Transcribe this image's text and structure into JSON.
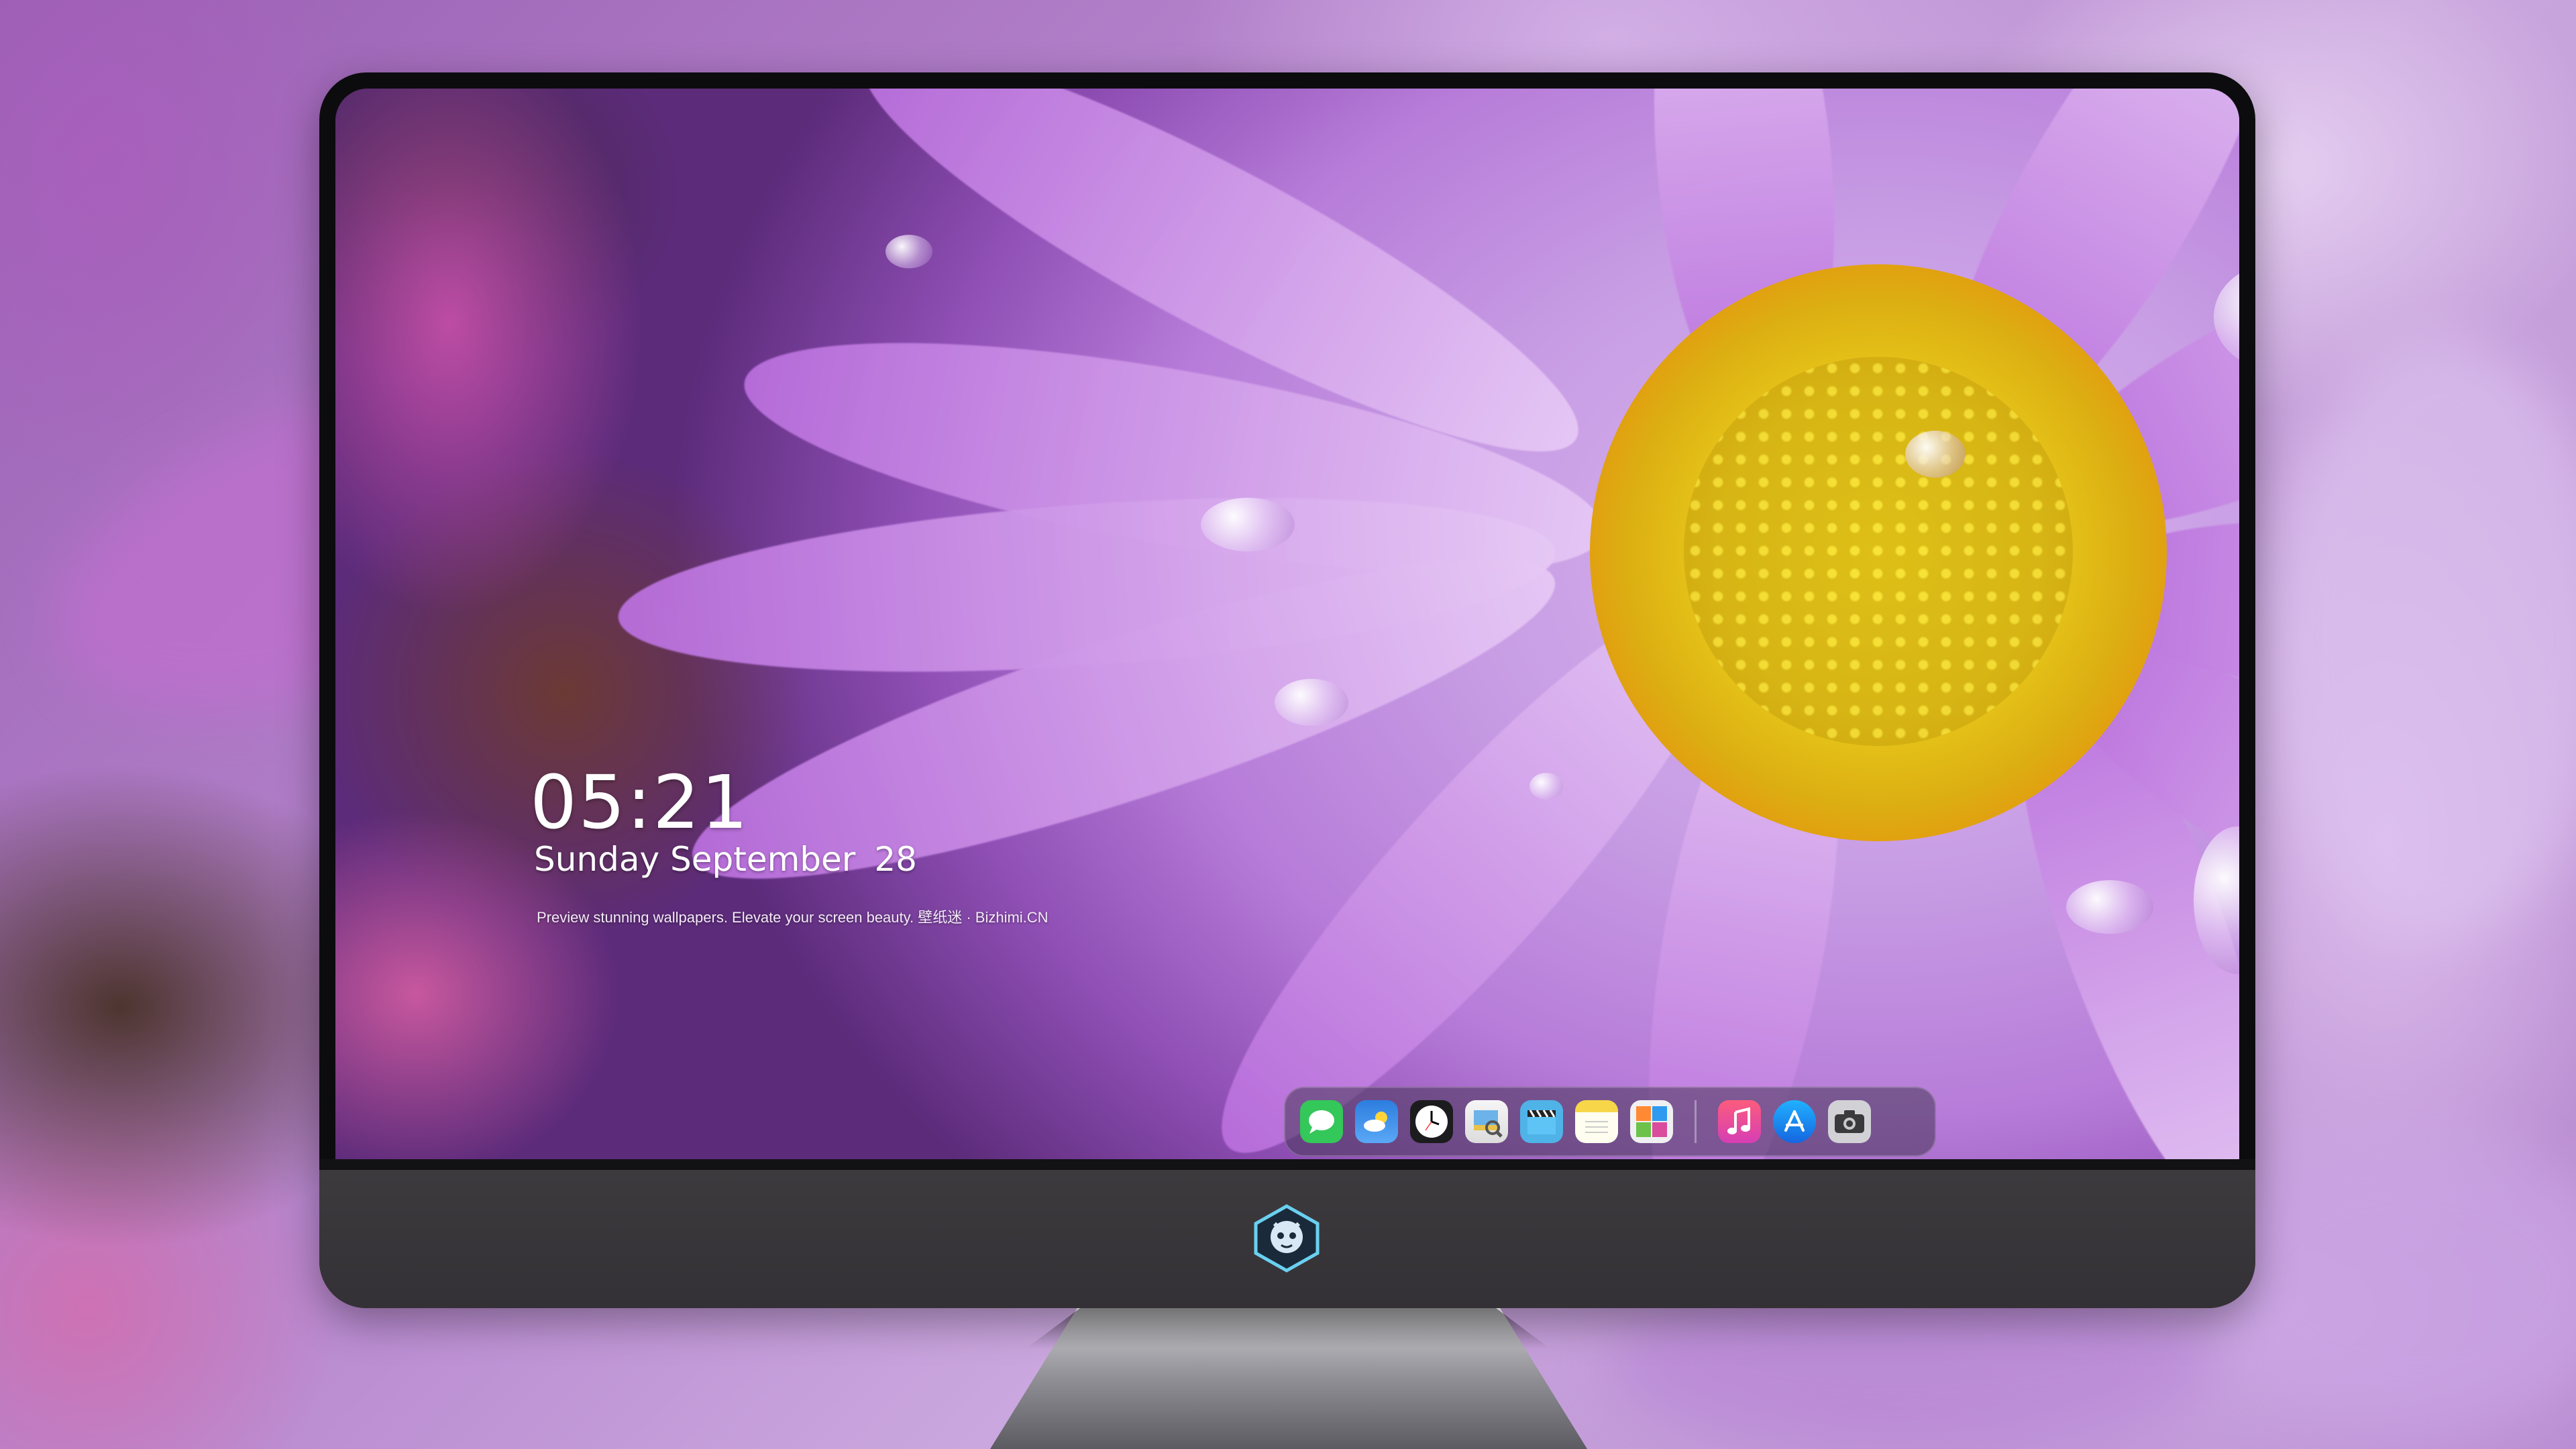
{
  "lock_screen": {
    "time": "05:21",
    "weekday_month": "Sunday September",
    "day": "28",
    "caption": "Preview stunning wallpapers. Elevate your screen beauty. 壁纸迷 · Bizhimi.CN"
  },
  "dock": {
    "apps": [
      {
        "name": "messages-icon",
        "color": "#34c759",
        "glyph": "💬"
      },
      {
        "name": "weather-icon",
        "color": "#3a8ef5",
        "glyph": "☁"
      },
      {
        "name": "clock-icon",
        "color": "#1c1c1e",
        "glyph": "🕓"
      },
      {
        "name": "preview-icon",
        "color": "#f2c94c",
        "glyph": "🔍"
      },
      {
        "name": "clips-icon",
        "color": "#4fb3e8",
        "glyph": "🎬"
      },
      {
        "name": "notes-icon",
        "color": "#f7d64a",
        "glyph": "≡"
      },
      {
        "name": "photo-booth-icon",
        "color": "#e5e5ea",
        "glyph": "▦"
      },
      {
        "name": "music-icon",
        "color": "#fc3c8d",
        "glyph": "♫"
      },
      {
        "name": "app-store-icon",
        "color": "#1e90ff",
        "glyph": "A"
      },
      {
        "name": "camera-icon",
        "color": "#6e6e73",
        "glyph": "📷"
      }
    ]
  },
  "colors": {
    "accent": "#c79ce4",
    "flower_center": "#f2d81e",
    "bezel": "#0c0c0e",
    "chin": "#3a373b"
  }
}
